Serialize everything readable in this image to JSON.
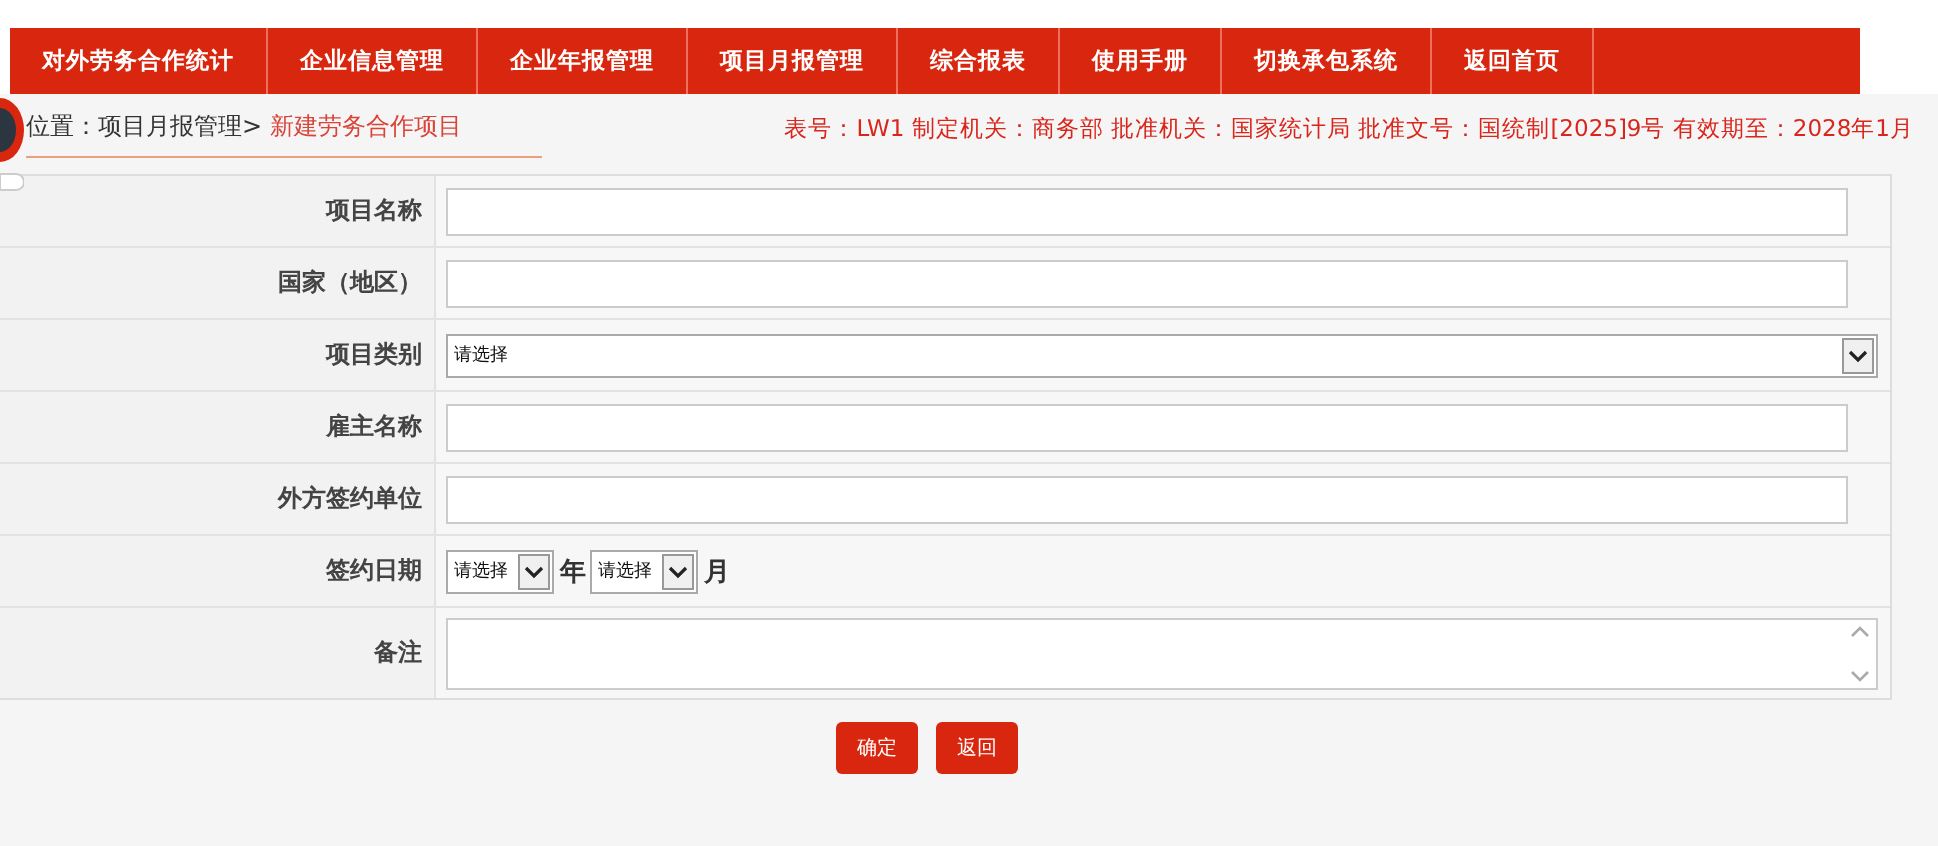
{
  "nav": {
    "items": [
      {
        "label": "对外劳务合作统计",
        "selected": false
      },
      {
        "label": "企业信息管理",
        "selected": false
      },
      {
        "label": "企业年报管理",
        "selected": false
      },
      {
        "label": "项目月报管理",
        "selected": false
      },
      {
        "label": "综合报表",
        "selected": false
      },
      {
        "label": "使用手册",
        "selected": false
      },
      {
        "label": "切换承包系统",
        "selected": false
      },
      {
        "label": "返回首页",
        "selected": false
      }
    ]
  },
  "breadcrumb": {
    "path": "位置：项目月报管理>",
    "current": "新建劳务合作项目"
  },
  "form_info": "表号：LW1 制定机关：商务部 批准机关：国家统计局 批准文号：国统制[2025]9号 有效期至：2028年1月",
  "form": {
    "rows": [
      {
        "kind": "text",
        "label": "项目名称"
      },
      {
        "kind": "text",
        "label": "国家（地区）"
      },
      {
        "kind": "select",
        "label": "项目类别",
        "value": "请选择"
      },
      {
        "kind": "text",
        "label": "雇主名称"
      },
      {
        "kind": "text",
        "label": "外方签约单位"
      },
      {
        "kind": "date",
        "label": "签约日期",
        "parts": [
          {
            "value": "请选择",
            "unit": "年"
          },
          {
            "value": "请选择",
            "unit": "月"
          }
        ]
      },
      {
        "kind": "textarea",
        "label": "备注"
      }
    ]
  },
  "buttons": [
    "确定",
    "返回"
  ]
}
